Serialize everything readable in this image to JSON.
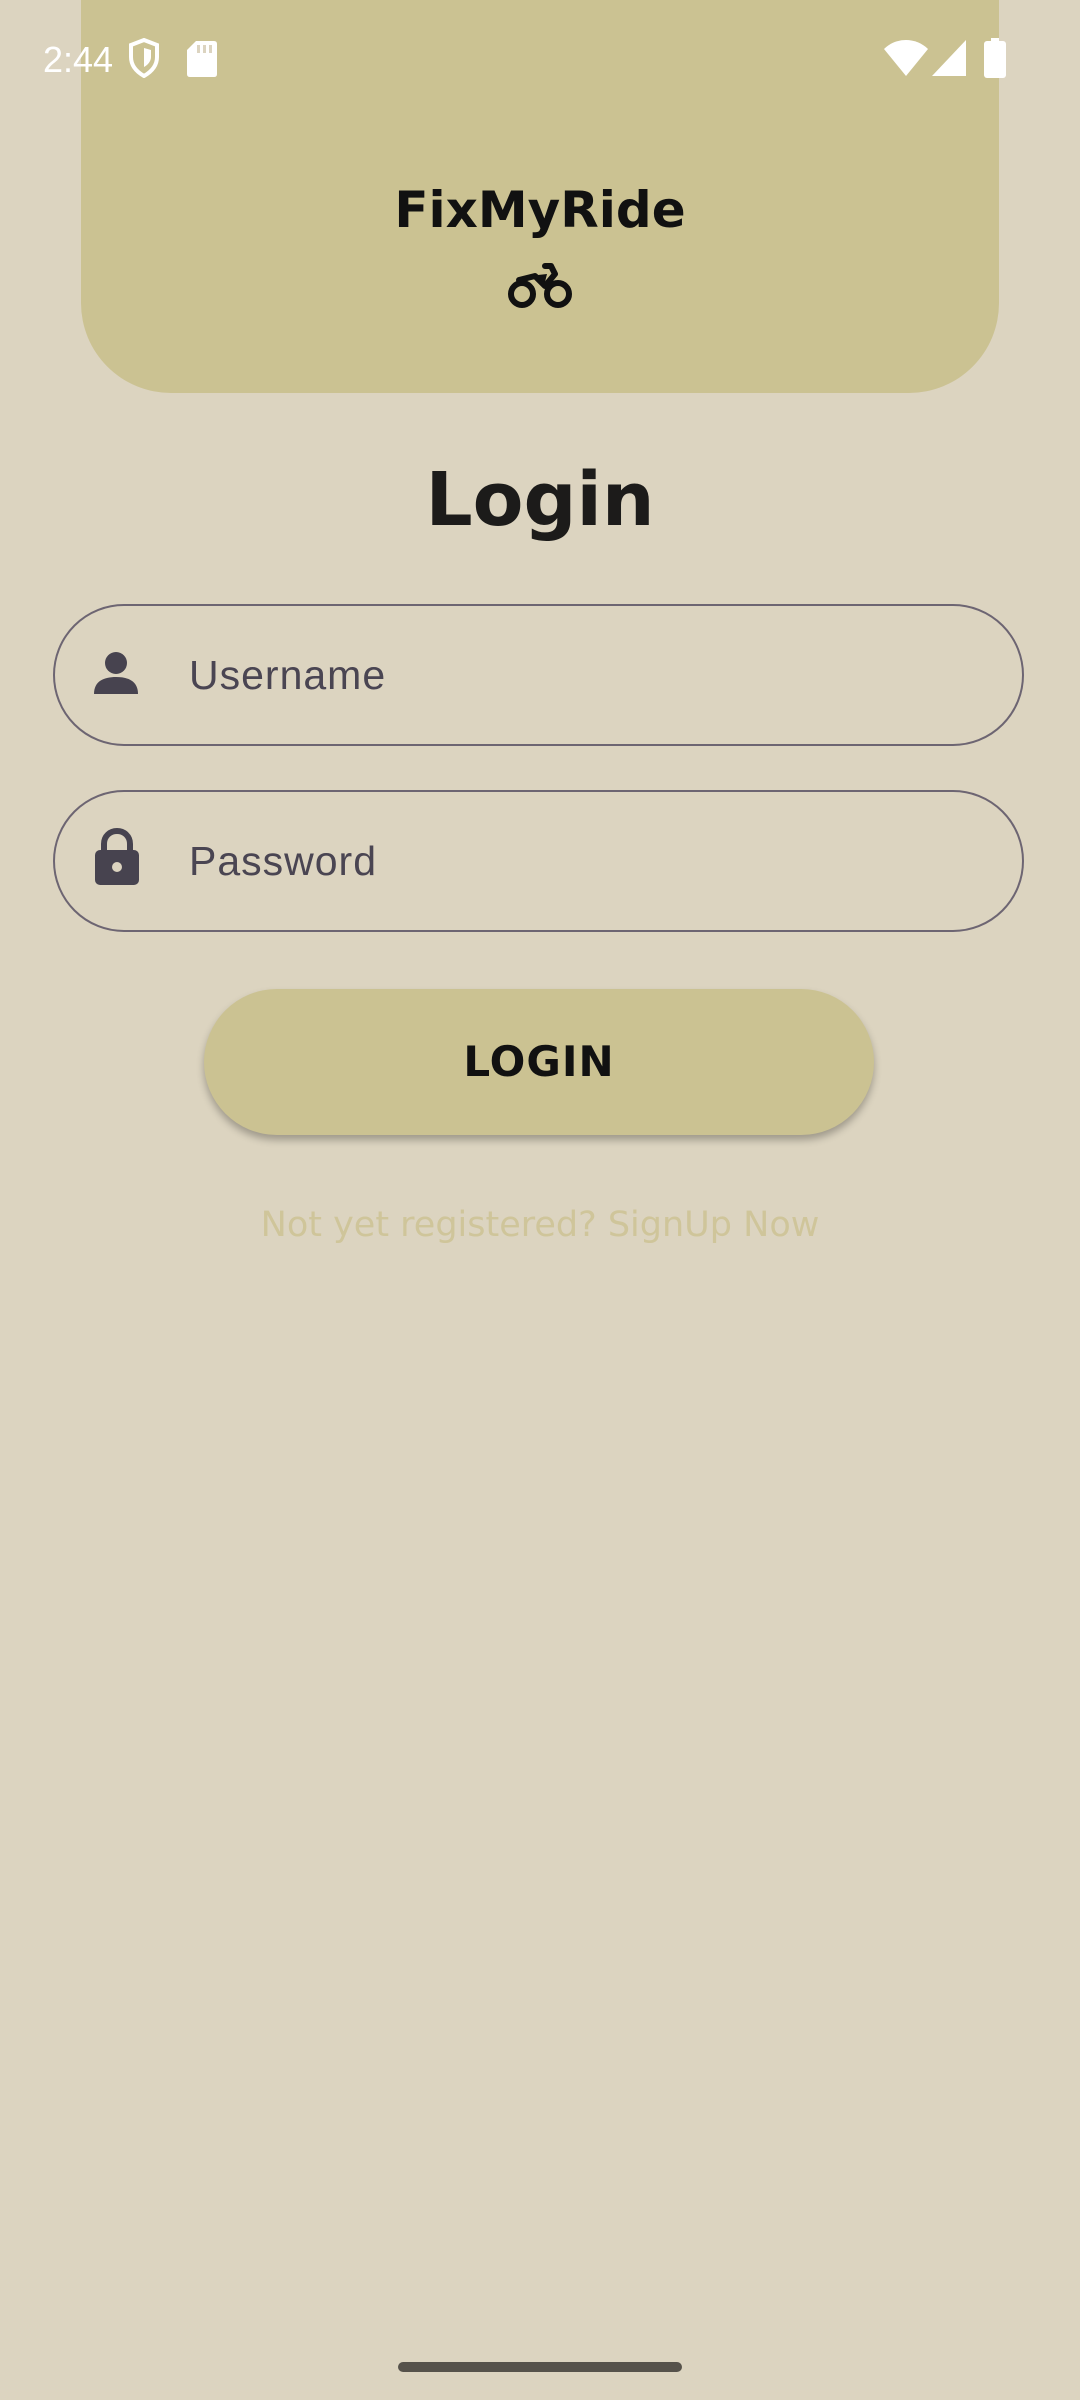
{
  "status_bar": {
    "time": "2:44",
    "icons": [
      "shield-icon",
      "sd-card-icon",
      "wifi-icon",
      "cell-signal-icon",
      "battery-icon"
    ]
  },
  "header": {
    "app_title": "FixMyRide",
    "logo_icon": "motorcycle-icon"
  },
  "page": {
    "title": "Login"
  },
  "form": {
    "username": {
      "placeholder": "Username",
      "value": "",
      "icon": "person-icon"
    },
    "password": {
      "placeholder": "Password",
      "value": "",
      "icon": "lock-icon"
    },
    "login_button_label": "LOGIN",
    "signup_link": "Not yet registered? SignUp Now"
  },
  "colors": {
    "background": "#dcd4c0",
    "accent": "#cbc292",
    "signup_link": "#cfc59a"
  }
}
